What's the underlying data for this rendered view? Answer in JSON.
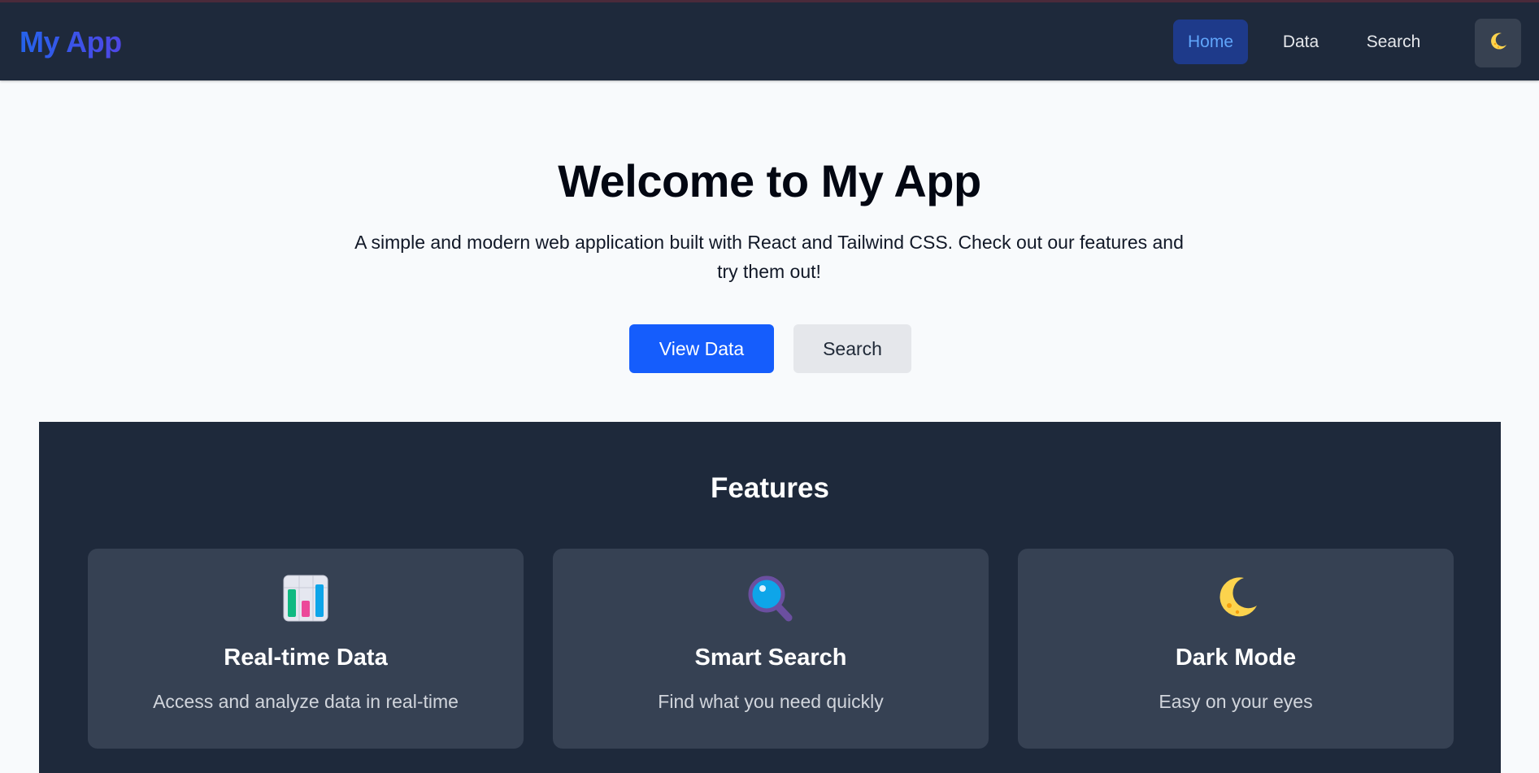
{
  "nav": {
    "brand": "My App",
    "links": [
      {
        "label": "Home",
        "active": true
      },
      {
        "label": "Data",
        "active": false
      },
      {
        "label": "Search",
        "active": false
      }
    ],
    "theme_toggle_icon": "moon-icon"
  },
  "hero": {
    "title": "Welcome to My App",
    "subtitle": "A simple and modern web application built with React and Tailwind CSS. Check out our features and try them out!",
    "primary_button": "View Data",
    "secondary_button": "Search"
  },
  "features": {
    "title": "Features",
    "items": [
      {
        "icon": "bar-chart-icon",
        "title": "Real-time Data",
        "description": "Access and analyze data in real-time"
      },
      {
        "icon": "magnifier-icon",
        "title": "Smart Search",
        "description": "Find what you need quickly"
      },
      {
        "icon": "moon-icon",
        "title": "Dark Mode",
        "description": "Easy on your eyes"
      }
    ]
  },
  "colors": {
    "nav_background": "#1e293b",
    "brand_gradient_start": "#2563eb",
    "brand_gradient_end": "#4f46e5",
    "primary_button": "#155dfc",
    "card_background": "#364153",
    "active_link_text": "#60a5fa"
  }
}
